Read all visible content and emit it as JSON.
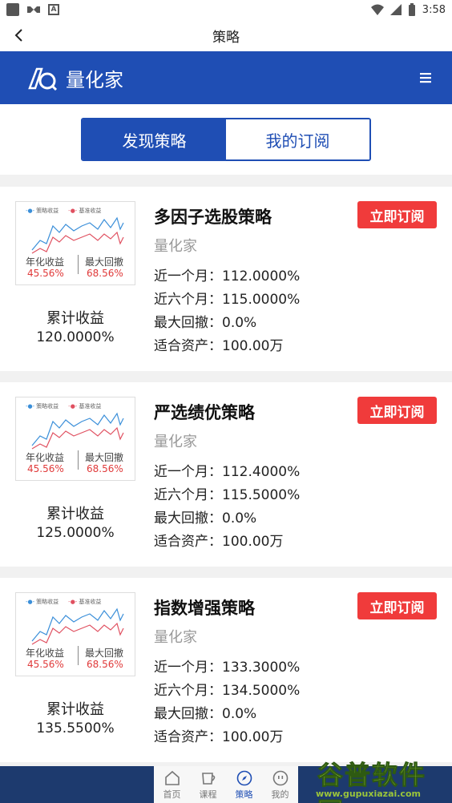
{
  "status": {
    "time": "3:58"
  },
  "titlebar": {
    "title": "策略"
  },
  "brand": {
    "name": "量化家"
  },
  "tabs": [
    {
      "label": "发现策略",
      "active": true
    },
    {
      "label": "我的订阅",
      "active": false
    }
  ],
  "thumb_common": {
    "legend_a": "策略收益",
    "legend_b": "基准收益",
    "annual_label": "年化收益",
    "annual_value": "45.56%",
    "drawdown_label": "最大回撤",
    "drawdown_value": "68.56%"
  },
  "strategies": [
    {
      "name": "多因子选股策略",
      "author": "量化家",
      "cum_label": "累计收益",
      "cum_value": "120.0000%",
      "month1": "近一个月：112.0000%",
      "month6": "近六个月：115.0000%",
      "drawdown": "最大回撤：0.0%",
      "assets": "适合资产：100.00万",
      "button": "立即订阅"
    },
    {
      "name": "严选绩优策略",
      "author": "量化家",
      "cum_label": "累计收益",
      "cum_value": "125.0000%",
      "month1": "近一个月：112.4000%",
      "month6": "近六个月：115.5000%",
      "drawdown": "最大回撤：0.0%",
      "assets": "适合资产：100.00万",
      "button": "立即订阅"
    },
    {
      "name": "指数增强策略",
      "author": "量化家",
      "cum_label": "累计收益",
      "cum_value": "135.5500%",
      "month1": "近一个月：133.3000%",
      "month6": "近六个月：134.5000%",
      "drawdown": "最大回撤：0.0%",
      "assets": "适合资产：100.00万",
      "button": "立即订阅"
    }
  ],
  "nav": [
    {
      "label": "首页",
      "icon": "home-icon",
      "active": false
    },
    {
      "label": "课程",
      "icon": "cup-icon",
      "active": false
    },
    {
      "label": "策略",
      "icon": "compass-icon",
      "active": true
    },
    {
      "label": "我的",
      "icon": "face-icon",
      "active": false
    }
  ],
  "watermark": {
    "title": "谷普软件园",
    "url": "www.gupuxiazai.com"
  },
  "colors": {
    "brand": "#1f4eb4",
    "subscribe": "#f03b3b",
    "strategy_line": "#3b8fd9",
    "benchmark_line": "#e05060"
  }
}
